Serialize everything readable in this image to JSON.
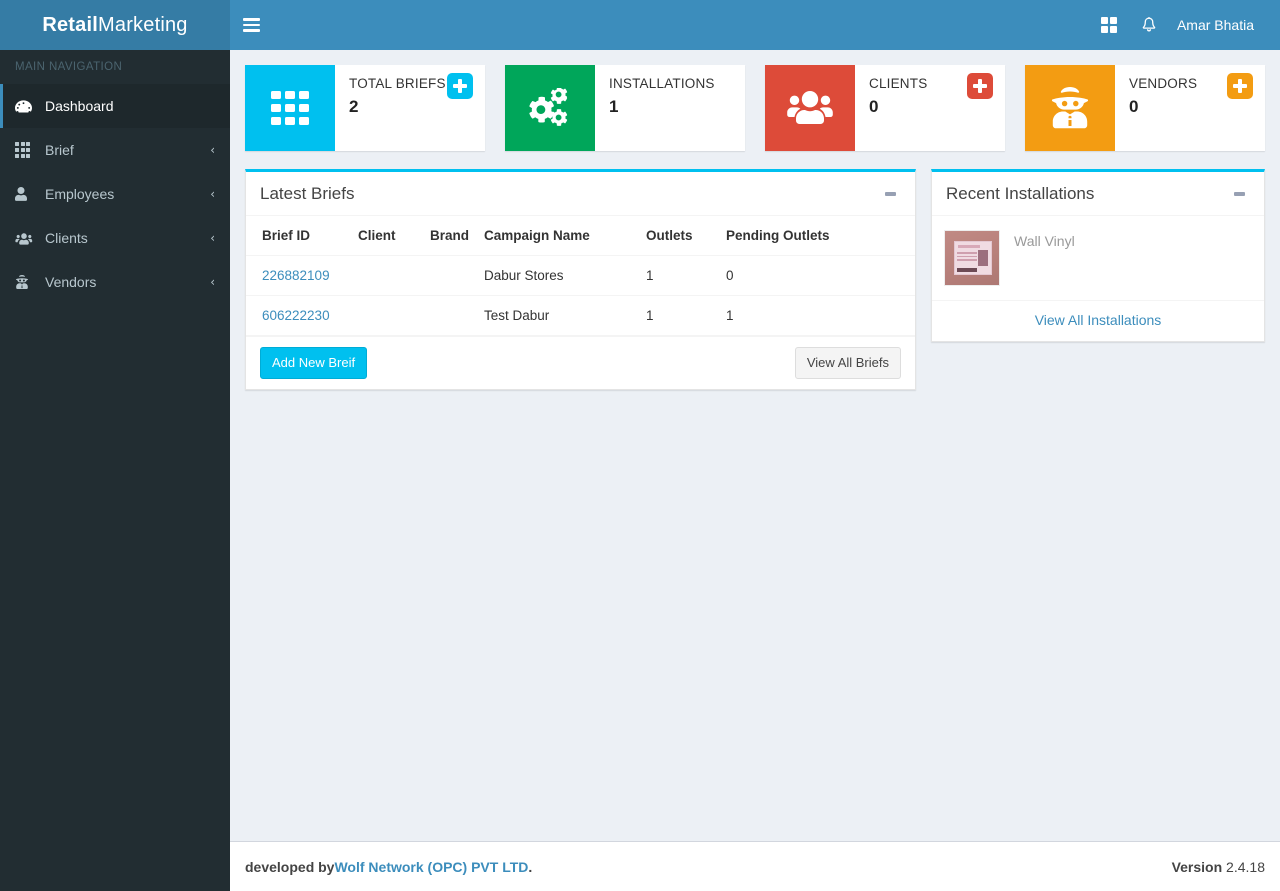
{
  "brand": {
    "bold": "Retail",
    "light": " Marketing"
  },
  "header": {
    "menu_toggle_icon": "hamburger-icon",
    "apps_icon": "grid-apps-icon",
    "notifications_icon": "bell-icon",
    "user_name": "Amar Bhatia"
  },
  "sidebar": {
    "section_label": "MAIN NAVIGATION",
    "items": [
      {
        "label": "Dashboard",
        "icon": "tachometer-icon",
        "active": true,
        "chevron": ""
      },
      {
        "label": "Brief",
        "icon": "th-grid-icon",
        "active": false,
        "chevron": "‹"
      },
      {
        "label": "Employees",
        "icon": "user-icon",
        "active": false,
        "chevron": "‹"
      },
      {
        "label": "Clients",
        "icon": "users-icon",
        "active": false,
        "chevron": "‹"
      },
      {
        "label": "Vendors",
        "icon": "user-secret-icon",
        "active": false,
        "chevron": "‹"
      }
    ]
  },
  "stat_boxes": [
    {
      "title": "TOTAL BRIEFS",
      "count": "2",
      "color": "#00c0ef",
      "icon": "th-grid-icon",
      "has_plus": true,
      "plus_icon": "plus-square-icon"
    },
    {
      "title": "INSTALLATIONS",
      "count": "1",
      "color": "#00a65a",
      "icon": "cogs-icon",
      "has_plus": false,
      "plus_icon": ""
    },
    {
      "title": "CLIENTS",
      "count": "0",
      "color": "#dd4b39",
      "icon": "users-icon",
      "has_plus": true,
      "plus_icon": "plus-square-icon"
    },
    {
      "title": "VENDORS",
      "count": "0",
      "color": "#f39c12",
      "icon": "user-secret-icon",
      "has_plus": true,
      "plus_icon": "plus-square-icon"
    }
  ],
  "latest_briefs": {
    "title": "Latest Briefs",
    "collapse_icon": "minus-icon",
    "columns": [
      "Brief ID",
      "Client",
      "Brand",
      "Campaign Name",
      "Outlets",
      "Pending Outlets"
    ],
    "rows": [
      {
        "brief_id": "226882109",
        "client": "",
        "brand": "",
        "campaign_name": "Dabur Stores",
        "outlets": "1",
        "pending_outlets": "0"
      },
      {
        "brief_id": "606222230",
        "client": "",
        "brand": "",
        "campaign_name": "Test Dabur",
        "outlets": "1",
        "pending_outlets": "1"
      }
    ],
    "add_button": "Add New Breif",
    "view_all_button": "View All Briefs"
  },
  "recent_installations": {
    "title": "Recent Installations",
    "collapse_icon": "minus-icon",
    "items": [
      {
        "name": "Wall Vinyl",
        "thumbnail": "installation-photo"
      }
    ],
    "view_all_link": "View All Installations"
  },
  "footer": {
    "developed_by": "developed by ",
    "company": "Wolf Network (OPC) PVT LTD",
    "period": ".",
    "version_label": "Version",
    "version_number": " 2.4.18"
  },
  "colors": {
    "navbar": "#3c8dbc",
    "logo_bg": "#357ca5",
    "sidebar": "#222d32",
    "content_bg": "#ecf0f5",
    "panel_border_top": "#00c0ef",
    "link": "#3c8dbc"
  }
}
